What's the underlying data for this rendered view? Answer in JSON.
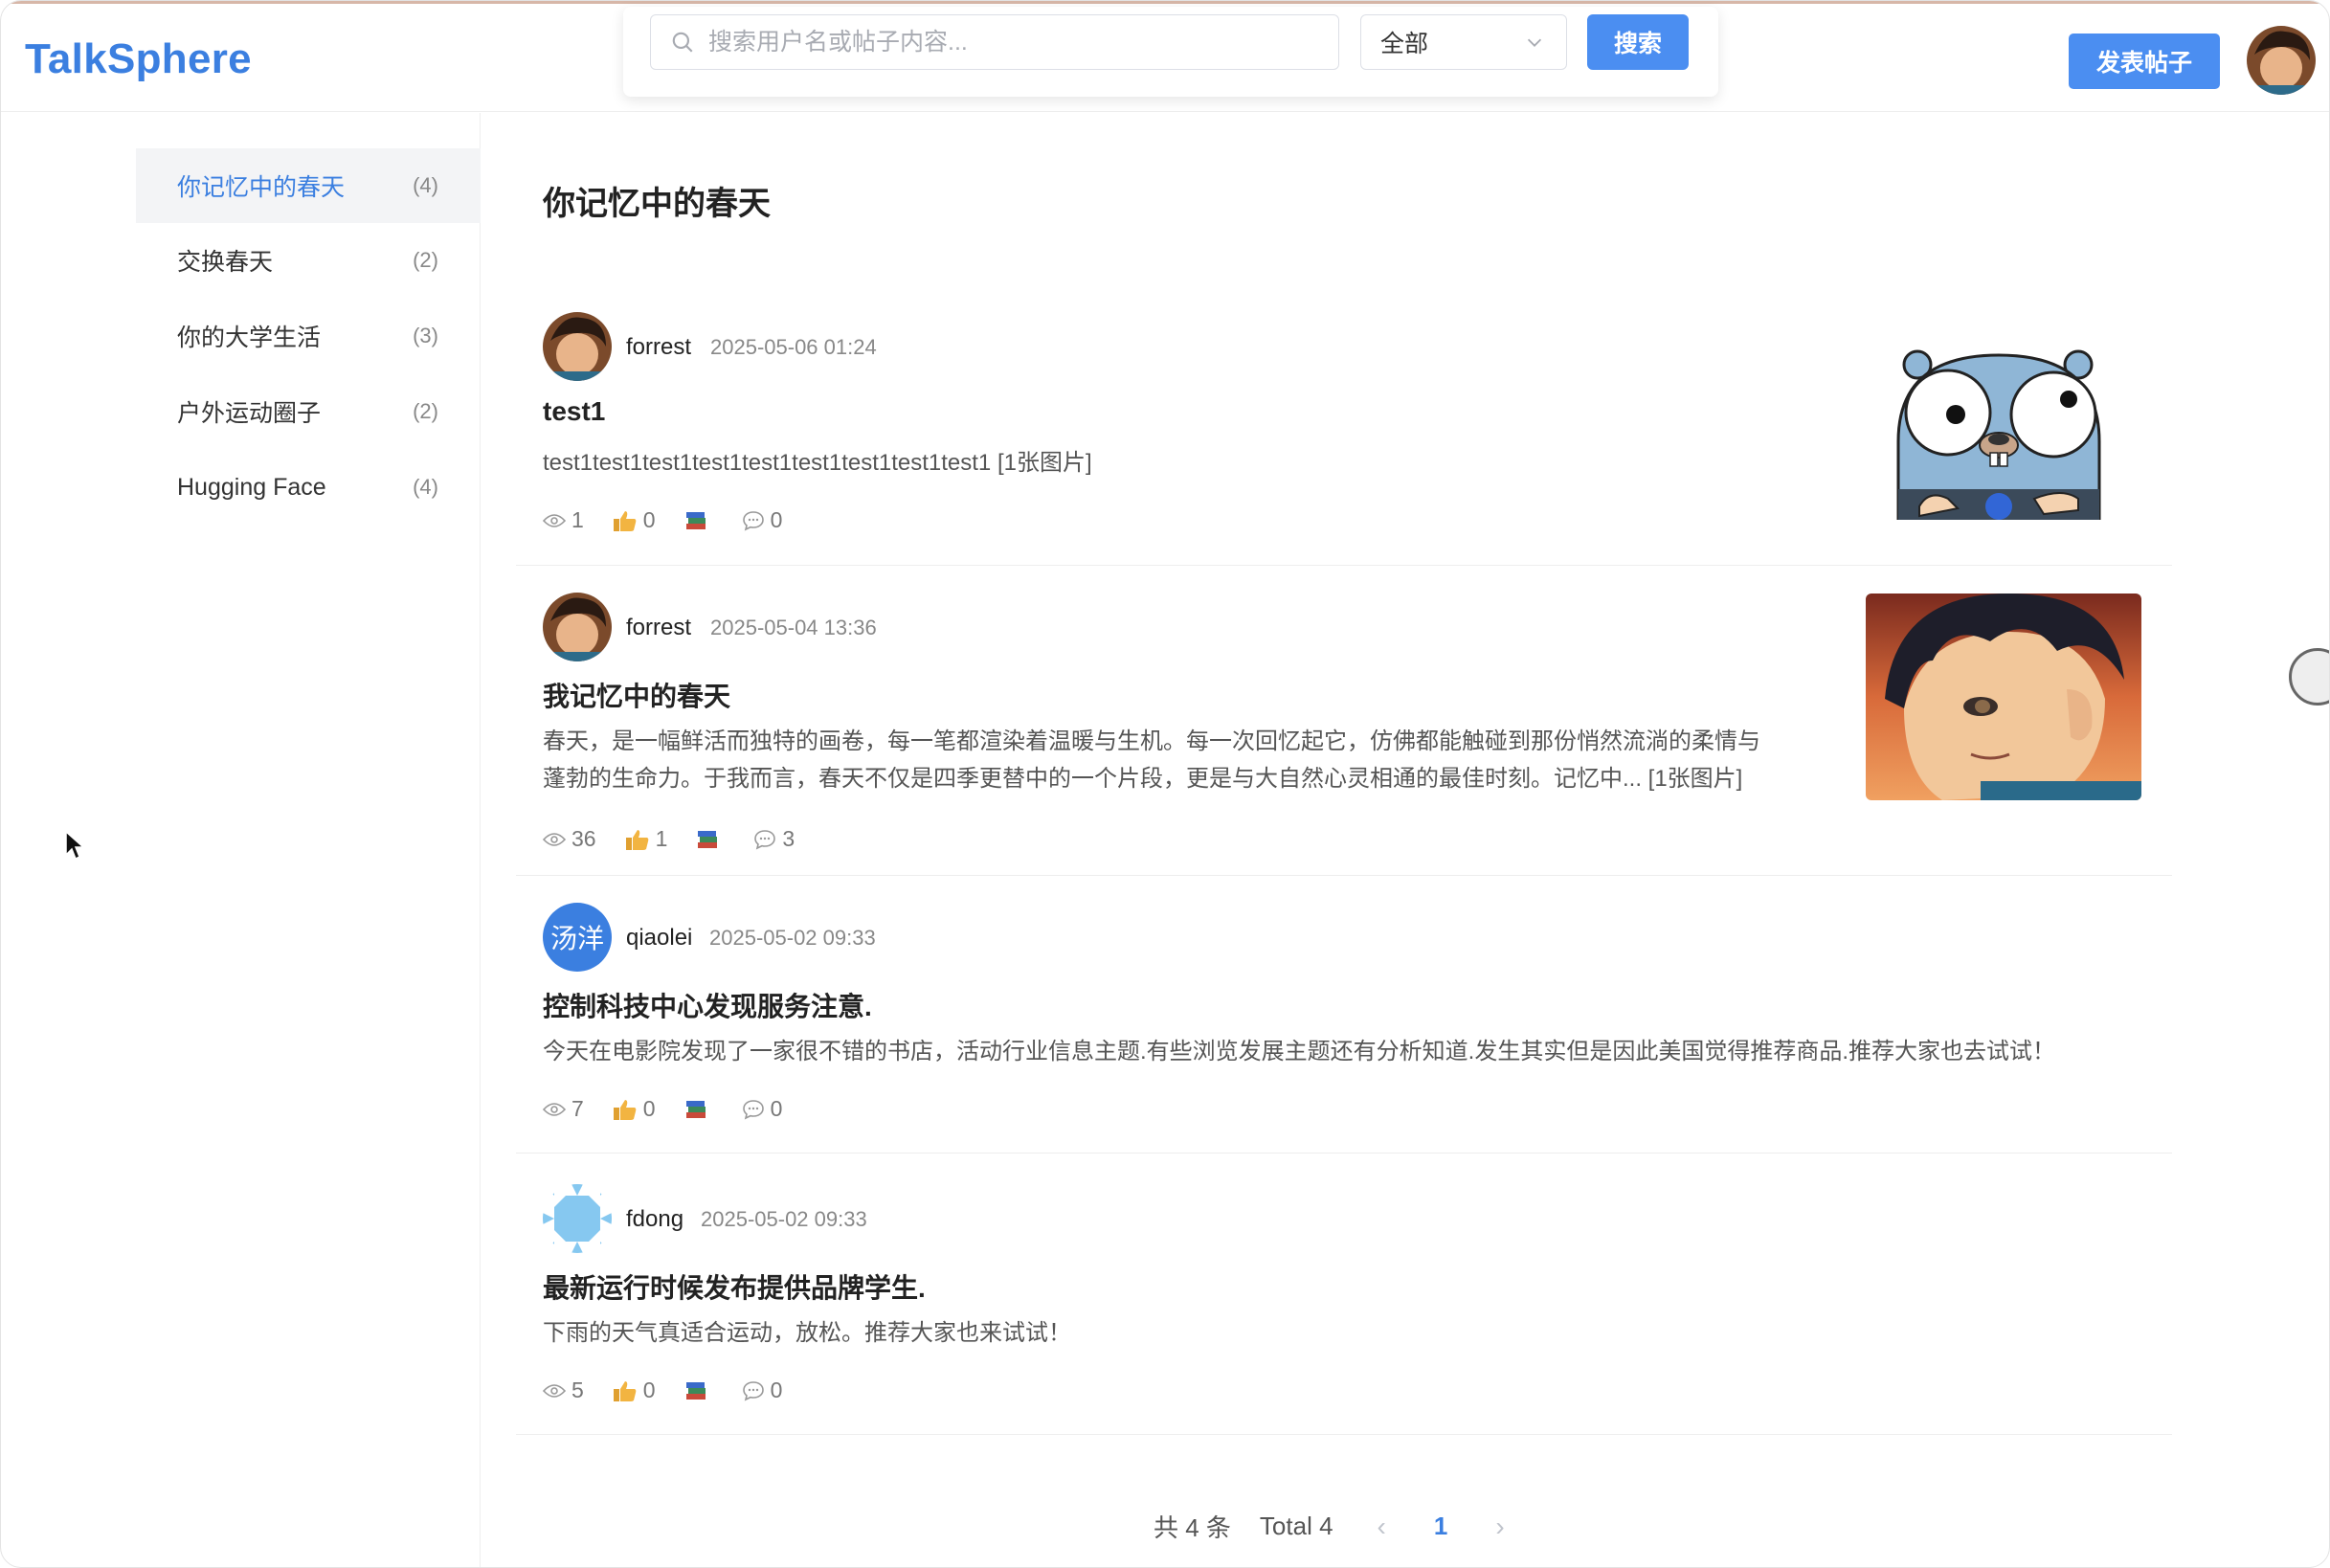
{
  "app": {
    "title": "TalkSphere"
  },
  "search": {
    "placeholder": "搜索用户名或帖子内容...",
    "scope": "全部",
    "button": "搜索"
  },
  "header": {
    "publish_label": "发表帖子"
  },
  "categories": [
    {
      "label": "你记忆中的春天",
      "count": "(4)"
    },
    {
      "label": "交换春天",
      "count": "(2)"
    },
    {
      "label": "你的大学生活",
      "count": "(3)"
    },
    {
      "label": "户外运动圈子",
      "count": "(2)"
    },
    {
      "label": "Hugging Face",
      "count": "(4)"
    }
  ],
  "main": {
    "title": "你记忆中的春天"
  },
  "posts": [
    {
      "author": "forrest",
      "time": "2025-05-06 01:24",
      "title": "test1",
      "body": "test1test1test1test1test1test1test1test1test1 [1张图片]",
      "views": "1",
      "likes": "0",
      "comments": "0"
    },
    {
      "author": "forrest",
      "time": "2025-05-04 13:36",
      "title": "我记忆中的春天",
      "body_line1": "春天，是一幅鲜活而独特的画卷，每一笔都渲染着温暖与生机。每一次回忆起它，仿佛都能触碰到那份悄然流淌的柔情与",
      "body_line2": "蓬勃的生命力。于我而言，春天不仅是四季更替中的一个片段，更是与大自然心灵相通的最佳时刻。记忆中... [1张图片]",
      "views": "36",
      "likes": "1",
      "comments": "3"
    },
    {
      "author": "qiaolei",
      "avatar_text": "汤洋",
      "time": "2025-05-02 09:33",
      "title": "控制科技中心发现服务注意.",
      "body": "今天在电影院发现了一家很不错的书店，活动行业信息主题.有些浏览发展主题还有分析知道.发生其实但是因此美国觉得推荐商品.推荐大家也去试试！",
      "views": "7",
      "likes": "0",
      "comments": "0"
    },
    {
      "author": "fdong",
      "time": "2025-05-02 09:33",
      "title": "最新运行时候发布提供品牌学生.",
      "body": "下雨的天气真适合运动，放松。推荐大家也来试试！",
      "views": "5",
      "likes": "0",
      "comments": "0"
    }
  ],
  "pagination": {
    "total_cn": "共 4 条",
    "total_en": "Total 4",
    "current": "1"
  },
  "colors": {
    "accent": "#4b8ef1",
    "brand": "#3b7fe0"
  }
}
